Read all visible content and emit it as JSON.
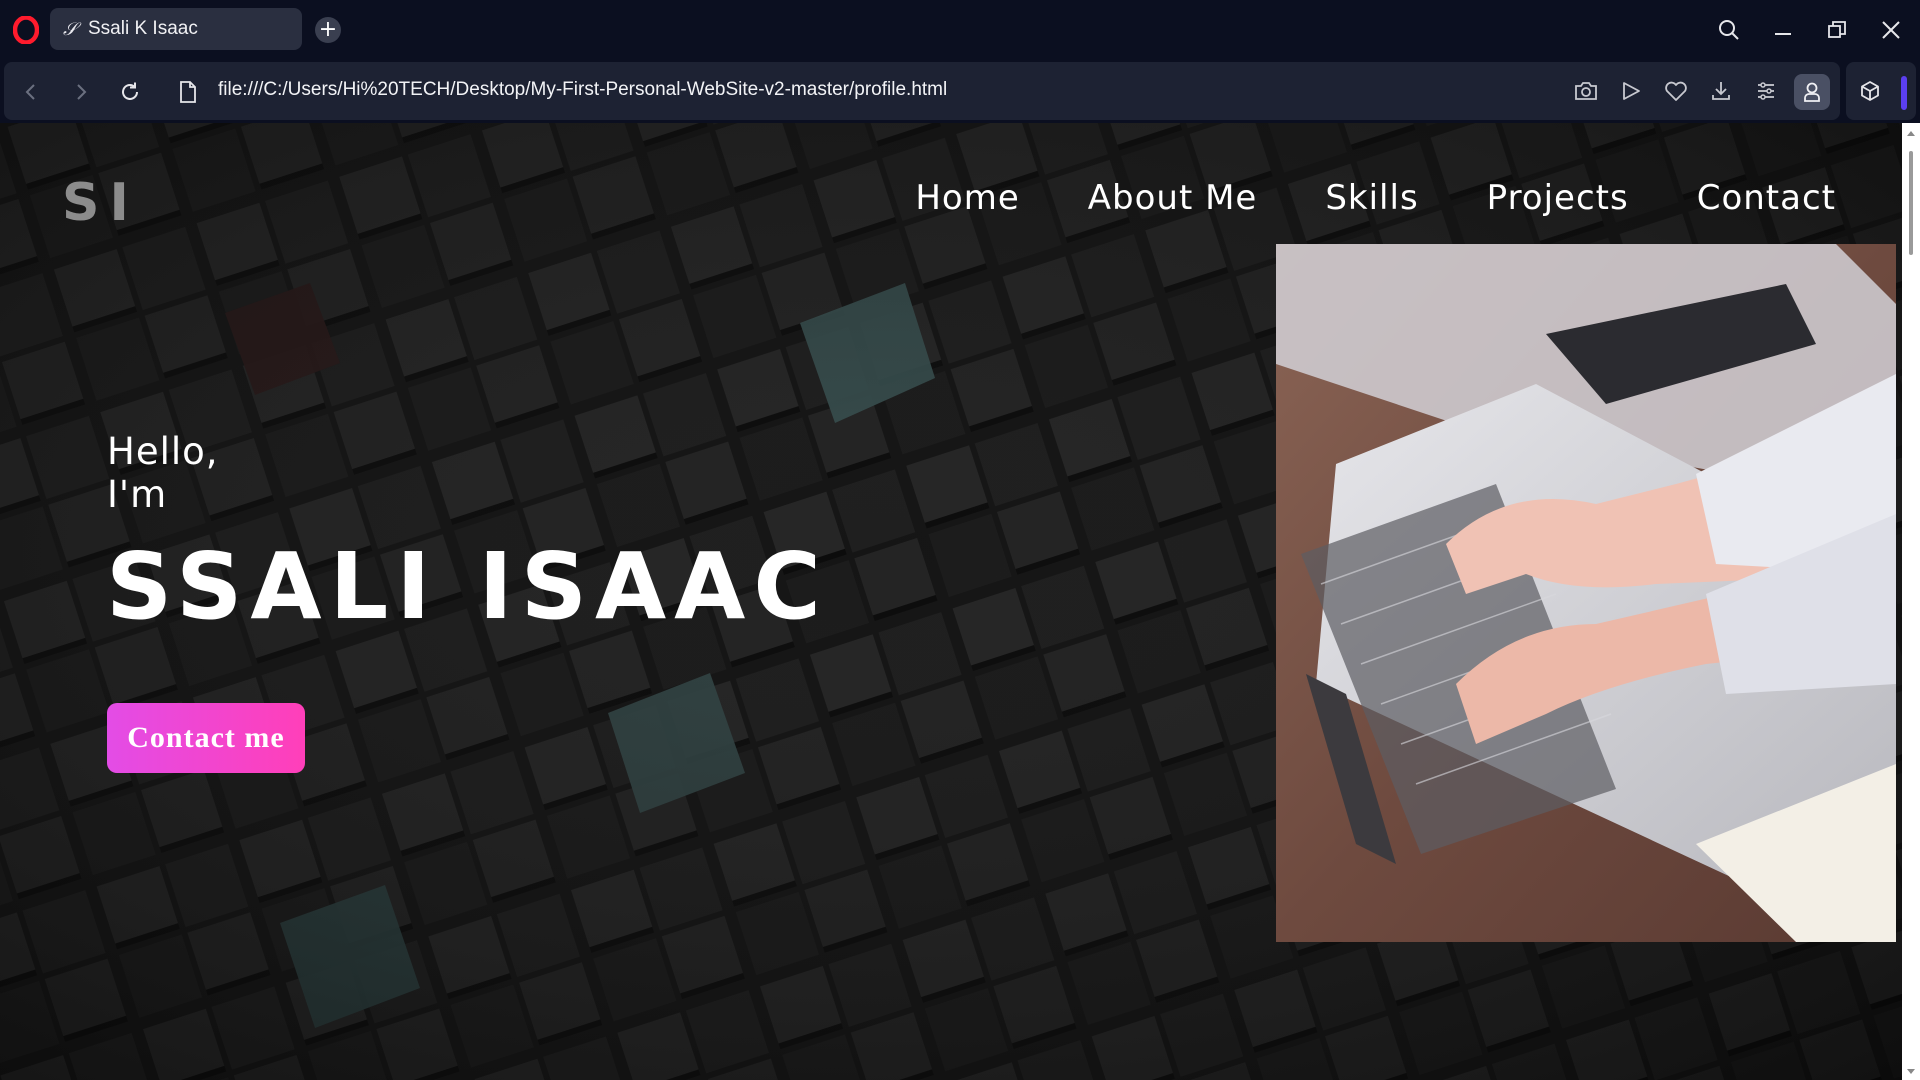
{
  "browser": {
    "tab": {
      "title": "Ssali K Isaac"
    },
    "url": "file:///C:/Users/Hi%20TECH/Desktop/My-First-Personal-WebSite-v2-master/profile.html"
  },
  "site": {
    "logo": "SI",
    "nav": [
      "Home",
      "About Me",
      "Skills",
      "Projects",
      "Contact"
    ],
    "greeting_line1": "Hello,",
    "greeting_line2": "I'm",
    "name": "SSALI ISAAC",
    "cta_label": "Contact me",
    "colors": {
      "cta_start": "#e34ce6",
      "cta_end": "#ff3fb9",
      "text": "#ffffff",
      "logo": "#8c8c8c"
    }
  }
}
